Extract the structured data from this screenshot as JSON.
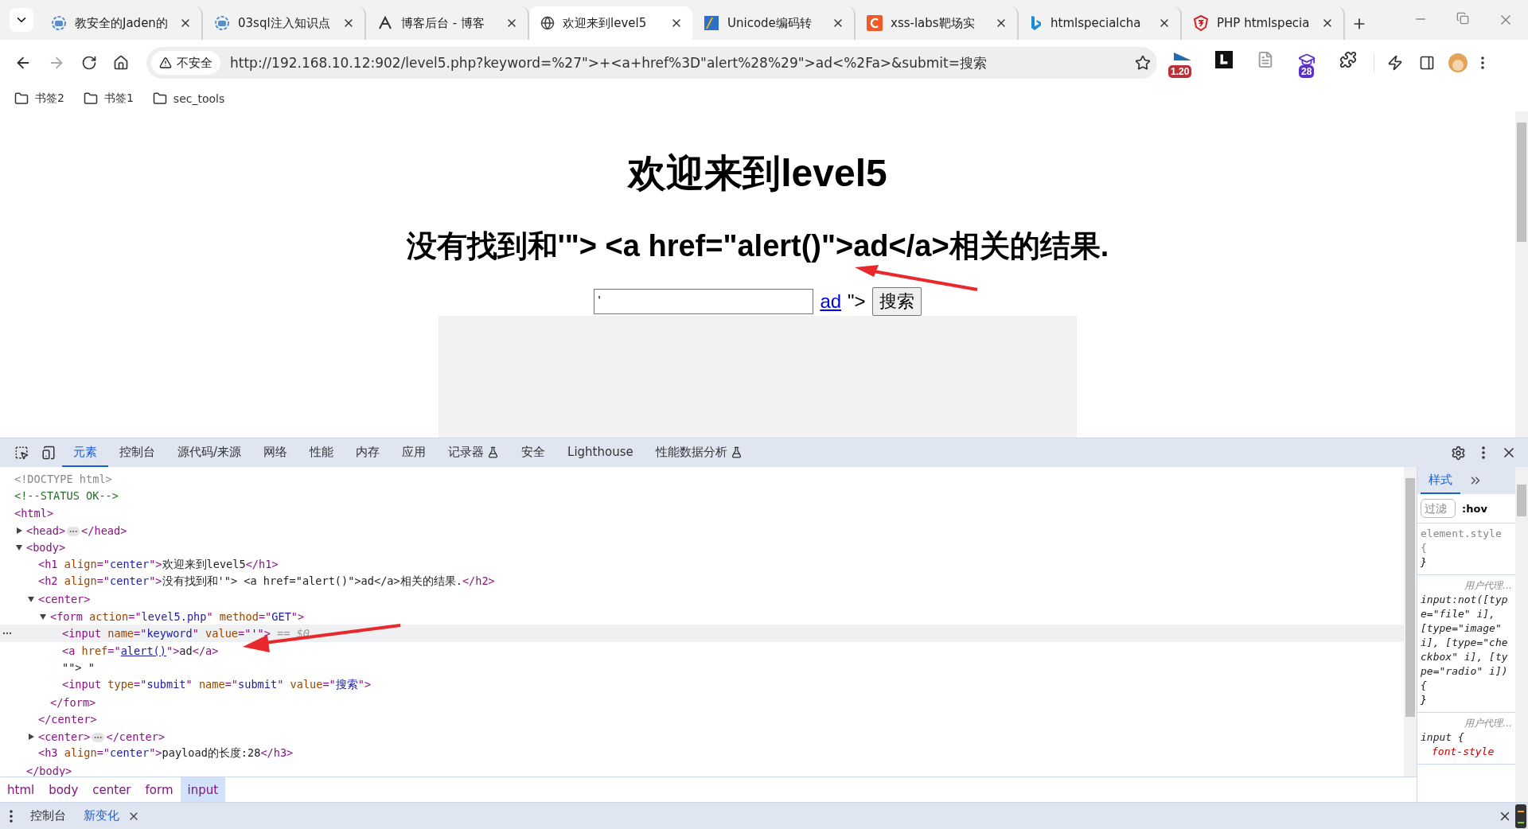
{
  "tabs": [
    {
      "title": "教安全的Jaden的",
      "selected": false
    },
    {
      "title": "03sql注入知识点",
      "selected": false
    },
    {
      "title": "博客后台 - 博客",
      "selected": false
    },
    {
      "title": "欢迎来到level5",
      "selected": true
    },
    {
      "title": "Unicode编码转",
      "selected": false
    },
    {
      "title": "xss-labs靶场实",
      "selected": false
    },
    {
      "title": "htmlspecialcha",
      "selected": false
    },
    {
      "title": "PHP htmlspecia",
      "selected": false
    }
  ],
  "address": {
    "security": "不安全",
    "url": "http://192.168.10.12:902/level5.php?keyword=%27\">+<a+href%3D\"alert%28%29\">ad<%2Fa>&submit=搜索"
  },
  "extensions": [
    {
      "kind": "meter",
      "badge": "1.20"
    },
    {
      "kind": "letter"
    },
    {
      "kind": "page"
    },
    {
      "kind": "cap",
      "badge": "28"
    },
    {
      "kind": "puzzle"
    }
  ],
  "bookmarks": [
    "书签2",
    "书签1",
    "sec_tools"
  ],
  "page": {
    "heading": "欢迎来到level5",
    "result": "没有找到和'\"> <a href=\"alert()\">ad</a>相关的结果.",
    "search_value": "'",
    "link": "ad",
    "after_link": "\">",
    "button": "搜索"
  },
  "devtools": {
    "tabs": [
      {
        "label": "元素",
        "selected": true,
        "experimental": false
      },
      {
        "label": "控制台",
        "selected": false,
        "experimental": false
      },
      {
        "label": "源代码/来源",
        "selected": false,
        "experimental": false
      },
      {
        "label": "网络",
        "selected": false,
        "experimental": false
      },
      {
        "label": "性能",
        "selected": false,
        "experimental": false
      },
      {
        "label": "内存",
        "selected": false,
        "experimental": false
      },
      {
        "label": "应用",
        "selected": false,
        "experimental": false
      },
      {
        "label": "记录器",
        "selected": false,
        "experimental": true
      },
      {
        "label": "安全",
        "selected": false,
        "experimental": false
      },
      {
        "label": "Lighthouse",
        "selected": false,
        "experimental": false
      },
      {
        "label": "性能数据分析",
        "selected": false,
        "experimental": true
      }
    ],
    "tree": [
      {
        "selected": false,
        "parts": [
          {
            "kind": "doctype",
            "text": "<!DOCTYPE html>"
          }
        ]
      },
      {
        "selected": false,
        "parts": [
          {
            "kind": "comment",
            "text": "<!--STATUS OK-->"
          }
        ]
      },
      {
        "selected": false,
        "parts": [
          {
            "kind": "tag",
            "text": "<html>"
          }
        ],
        "children": [
          {
            "selected": false,
            "expanded": false,
            "parts": [
              {
                "kind": "tag",
                "text": "<head>"
              },
              {
                "kind": "more"
              },
              {
                "kind": "tag",
                "text": "</head>"
              }
            ]
          },
          {
            "selected": false,
            "expanded": true,
            "parts": [
              {
                "kind": "tag",
                "text": "<body>"
              }
            ],
            "close": [
              {
                "kind": "tag",
                "text": "</body>"
              }
            ],
            "children": [
              {
                "selected": false,
                "parts": [
                  {
                    "kind": "tag",
                    "text": "<h1 "
                  },
                  {
                    "kind": "attr",
                    "text": "align"
                  },
                  {
                    "kind": "tag",
                    "text": "=\""
                  },
                  {
                    "kind": "val",
                    "text": "center"
                  },
                  {
                    "kind": "tag",
                    "text": "\">"
                  },
                  {
                    "kind": "text",
                    "text": "欢迎来到level5"
                  },
                  {
                    "kind": "tag",
                    "text": "</h1>"
                  }
                ]
              },
              {
                "selected": false,
                "parts": [
                  {
                    "kind": "tag",
                    "text": "<h2 "
                  },
                  {
                    "kind": "attr",
                    "text": "align"
                  },
                  {
                    "kind": "tag",
                    "text": "=\""
                  },
                  {
                    "kind": "val",
                    "text": "center"
                  },
                  {
                    "kind": "tag",
                    "text": "\">"
                  },
                  {
                    "kind": "text",
                    "text": "没有找到和'\"> <a href=\"alert()\">ad</a>相关的结果."
                  },
                  {
                    "kind": "tag",
                    "text": "</h2>"
                  }
                ]
              },
              {
                "selected": false,
                "expanded": true,
                "parts": [
                  {
                    "kind": "tag",
                    "text": "<center>"
                  }
                ],
                "close": [
                  {
                    "kind": "tag",
                    "text": "</center>"
                  }
                ],
                "children": [
                  {
                    "selected": false,
                    "expanded": true,
                    "parts": [
                      {
                        "kind": "tag",
                        "text": "<form "
                      },
                      {
                        "kind": "attr",
                        "text": "action"
                      },
                      {
                        "kind": "tag",
                        "text": "=\""
                      },
                      {
                        "kind": "val",
                        "text": "level5.php"
                      },
                      {
                        "kind": "tag",
                        "text": "\" "
                      },
                      {
                        "kind": "attr",
                        "text": "method"
                      },
                      {
                        "kind": "tag",
                        "text": "=\""
                      },
                      {
                        "kind": "val",
                        "text": "GET"
                      },
                      {
                        "kind": "tag",
                        "text": "\">"
                      }
                    ],
                    "close": [
                      {
                        "kind": "tag",
                        "text": "</form>"
                      }
                    ],
                    "children": [
                      {
                        "selected": true,
                        "parts": [
                          {
                            "kind": "tag",
                            "text": "<input "
                          },
                          {
                            "kind": "attr",
                            "text": "name"
                          },
                          {
                            "kind": "tag",
                            "text": "=\""
                          },
                          {
                            "kind": "val",
                            "text": "keyword"
                          },
                          {
                            "kind": "tag",
                            "text": "\" "
                          },
                          {
                            "kind": "attr",
                            "text": "value"
                          },
                          {
                            "kind": "tag",
                            "text": "=\""
                          },
                          {
                            "kind": "val",
                            "text": "'"
                          },
                          {
                            "kind": "tag",
                            "text": "\">"
                          },
                          {
                            "kind": "eq",
                            "text": " == $0"
                          }
                        ]
                      },
                      {
                        "selected": false,
                        "parts": [
                          {
                            "kind": "tag",
                            "text": "<a "
                          },
                          {
                            "kind": "attr",
                            "text": "href"
                          },
                          {
                            "kind": "tag",
                            "text": "=\""
                          },
                          {
                            "kind": "link",
                            "text": "alert()"
                          },
                          {
                            "kind": "tag",
                            "text": "\">"
                          },
                          {
                            "kind": "text",
                            "text": "ad"
                          },
                          {
                            "kind": "tag",
                            "text": "</a>"
                          }
                        ]
                      },
                      {
                        "selected": false,
                        "parts": [
                          {
                            "kind": "text",
                            "text": "\"\"> \""
                          }
                        ]
                      },
                      {
                        "selected": false,
                        "parts": [
                          {
                            "kind": "tag",
                            "text": "<input "
                          },
                          {
                            "kind": "attr",
                            "text": "type"
                          },
                          {
                            "kind": "tag",
                            "text": "=\""
                          },
                          {
                            "kind": "val",
                            "text": "submit"
                          },
                          {
                            "kind": "tag",
                            "text": "\" "
                          },
                          {
                            "kind": "attr",
                            "text": "name"
                          },
                          {
                            "kind": "tag",
                            "text": "=\""
                          },
                          {
                            "kind": "val",
                            "text": "submit"
                          },
                          {
                            "kind": "tag",
                            "text": "\" "
                          },
                          {
                            "kind": "attr",
                            "text": "value"
                          },
                          {
                            "kind": "tag",
                            "text": "=\""
                          },
                          {
                            "kind": "val",
                            "text": "搜索"
                          },
                          {
                            "kind": "tag",
                            "text": "\">"
                          }
                        ]
                      }
                    ]
                  }
                ]
              },
              {
                "selected": false,
                "expanded": false,
                "parts": [
                  {
                    "kind": "tag",
                    "text": "<center>"
                  },
                  {
                    "kind": "more"
                  },
                  {
                    "kind": "tag",
                    "text": "</center>"
                  }
                ]
              },
              {
                "selected": false,
                "parts": [
                  {
                    "kind": "tag",
                    "text": "<h3 "
                  },
                  {
                    "kind": "attr",
                    "text": "align"
                  },
                  {
                    "kind": "tag",
                    "text": "=\""
                  },
                  {
                    "kind": "val",
                    "text": "center"
                  },
                  {
                    "kind": "tag",
                    "text": "\">"
                  },
                  {
                    "kind": "text",
                    "text": "payload的长度:28"
                  },
                  {
                    "kind": "tag",
                    "text": "</h3>"
                  }
                ]
              }
            ]
          }
        ]
      }
    ],
    "breadcrumbs": [
      {
        "label": "html",
        "selected": false
      },
      {
        "label": "body",
        "selected": false
      },
      {
        "label": "center",
        "selected": false
      },
      {
        "label": "form",
        "selected": false
      },
      {
        "label": "input",
        "selected": true
      }
    ],
    "styles": {
      "tab": "样式",
      "placeholder": "过滤",
      "hov": ":hov",
      "rules": [
        {
          "kind": "inline",
          "selector": "element.style",
          "open": "{",
          "close": "}"
        },
        {
          "kind": "agent",
          "origin": "用户代理…",
          "selector": "input:not([type=\"file\" i], [type=\"image\" i], [type=\"checkbox\" i], [type=\"radio\" i])",
          "open": "{",
          "close": "}"
        },
        {
          "kind": "agent",
          "origin": "用户代理…",
          "selector": "input",
          "open": "{",
          "props": [
            "font-style"
          ]
        }
      ]
    },
    "drawer": [
      {
        "label": "控制台",
        "selected": false,
        "closable": false
      },
      {
        "label": "新变化",
        "selected": true,
        "closable": true
      }
    ]
  }
}
